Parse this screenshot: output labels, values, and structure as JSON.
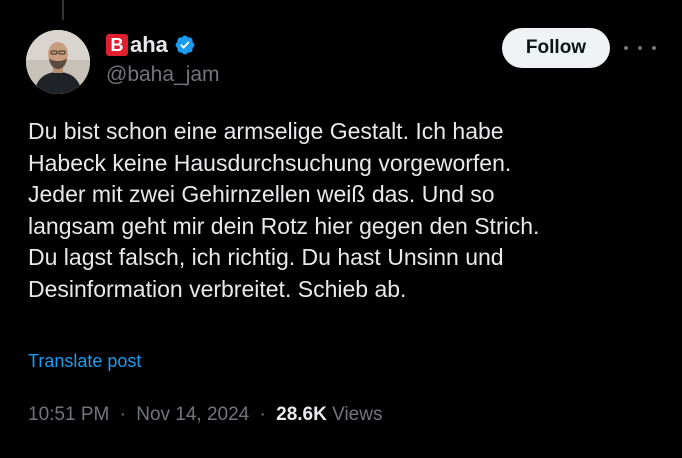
{
  "author": {
    "brand_letter": "B",
    "display_name": "aha",
    "handle": "@baha_jam",
    "verified": true,
    "avatar": "profile-photo"
  },
  "actions": {
    "follow_label": "Follow",
    "more_icon": "more-horizontal-icon"
  },
  "tweet": {
    "lines": [
      "Du bist schon eine armselige Gestalt. Ich habe",
      "Habeck keine Hausdurchsuchung vorgeworfen.",
      "Jeder mit zwei Gehirnzellen weiß das. Und so",
      "langsam geht mir dein Rotz hier gegen den Strich.",
      "Du lagst falsch, ich richtig. Du hast Unsinn und",
      "Desinformation verbreitet. Schieb ab."
    ],
    "translate_label": "Translate post"
  },
  "meta": {
    "time": "10:51 PM",
    "separator": "·",
    "date": "Nov 14, 2024",
    "views_count": "28.6K",
    "views_label": "Views"
  },
  "colors": {
    "background": "#000000",
    "text": "#e7e9ea",
    "muted": "#71767b",
    "accent": "#1d9bf0",
    "brand_red": "#e0202e"
  }
}
